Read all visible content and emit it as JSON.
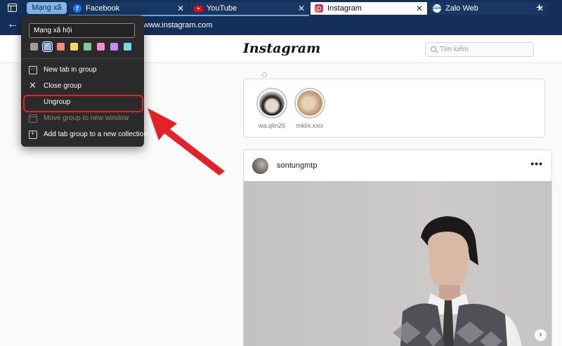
{
  "tabstrip": {
    "group_label": "Mạng xã hội",
    "tabs": [
      {
        "label": "Facebook",
        "icon": "facebook-icon"
      },
      {
        "label": "YouTube",
        "icon": "youtube-icon"
      },
      {
        "label": "Instagram",
        "icon": "instagram-icon"
      },
      {
        "label": "Zalo Web",
        "icon": "zalo-icon"
      }
    ],
    "close_glyph": "✕",
    "new_tab_glyph": "+"
  },
  "address_bar": {
    "url": "www.instagram.com"
  },
  "instagram": {
    "logo": "Instagram",
    "search_placeholder": "Tìm kiếm",
    "stories": [
      {
        "name": "wa.qlin26"
      },
      {
        "name": "mklix.xxix"
      }
    ],
    "post": {
      "username": "sontungmtp",
      "more_glyph": "•••"
    }
  },
  "group_menu": {
    "name_value": "Mạng xã hội",
    "colors": [
      "#9e9e9e",
      "#8ab4f8",
      "#f28b82",
      "#fdd663",
      "#81c995",
      "#ff8bcb",
      "#c58af9",
      "#78d9ec"
    ],
    "selected_color_index": 1,
    "items": [
      {
        "label": "New tab in group",
        "enabled": true
      },
      {
        "label": "Close group",
        "enabled": true
      },
      {
        "label": "Ungroup",
        "enabled": true,
        "highlighted": true
      },
      {
        "label": "Move group to new window",
        "enabled": false
      },
      {
        "label": "Add tab group to a new collection",
        "enabled": true
      }
    ]
  },
  "annotation": {
    "arrow_color": "#e52128"
  }
}
